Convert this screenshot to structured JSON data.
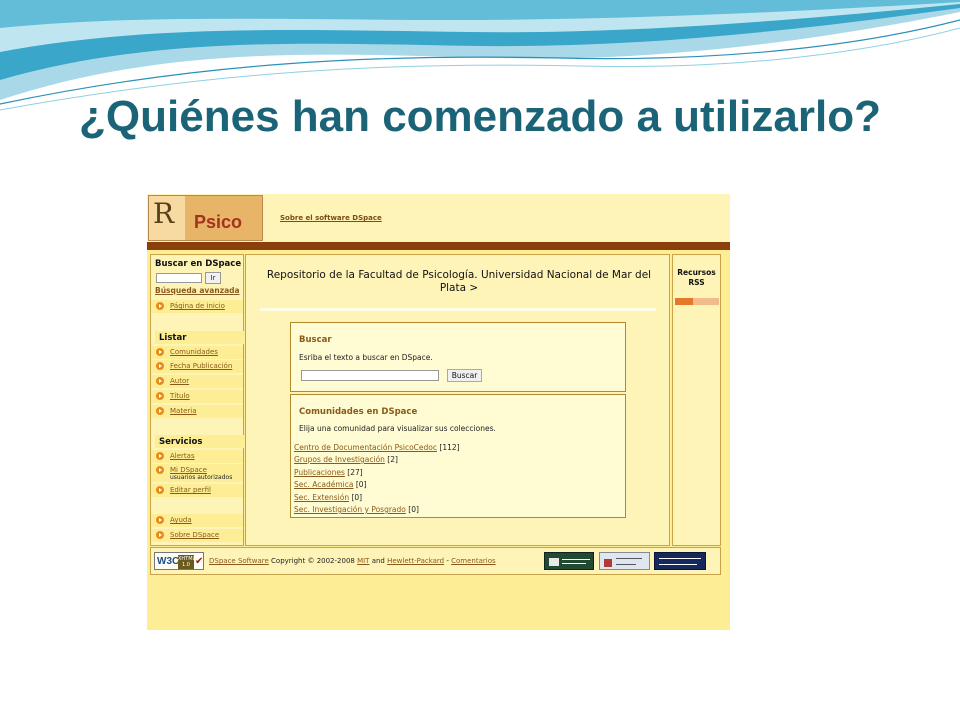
{
  "slide": {
    "title": "¿Quiénes han comenzado a utilizarlo?"
  },
  "header": {
    "logo_letter": "R",
    "logo_name": "Psico",
    "about_link": "Sobre el software DSpace"
  },
  "sidebar": {
    "search_title": "Buscar en DSpace",
    "search_button": "Ir",
    "advanced_link": "Búsqueda avanzada",
    "home_link": "Página de inicio",
    "list_title": "Listar",
    "list_items": [
      {
        "label": "Comunidades"
      },
      {
        "label": "Fecha Publicación"
      },
      {
        "label": "Autor"
      },
      {
        "label": "Título"
      },
      {
        "label": "Materia"
      }
    ],
    "services_title": "Servicios",
    "service_items": [
      {
        "label": "Alertas"
      },
      {
        "label": "Mi DSpace",
        "sub": "usuarios autorizados"
      },
      {
        "label": "Editar perfil"
      }
    ],
    "help_items": [
      {
        "label": "Ayuda"
      },
      {
        "label": "Sobre DSpace"
      }
    ]
  },
  "main": {
    "repo_title": "Repositorio de la Facultad de Psicología. Universidad Nacional de Mar del Plata >",
    "search_box": {
      "title": "Buscar",
      "prompt": "Esriba el texto a buscar en DSpace.",
      "button": "Buscar"
    },
    "communities_box": {
      "title": "Comunidades en DSpace",
      "prompt": "Elija una comunidad para visualizar sus colecciones.",
      "items": [
        {
          "name": "Centro de Documentación PsicoCedoc",
          "count": "[112]"
        },
        {
          "name": "Grupos de Investigación",
          "count": "[2]"
        },
        {
          "name": "Publicaciones",
          "count": "[27]"
        },
        {
          "name": "Sec. Académica",
          "count": "[0]"
        },
        {
          "name": "Sec. Extensión",
          "count": "[0]"
        },
        {
          "name": "Sec. Investigación y Posgrado",
          "count": "[0]"
        }
      ]
    }
  },
  "right": {
    "rss_title_line1": "Recursos",
    "rss_title_line2": "RSS"
  },
  "footer": {
    "w3c_label": "W3C",
    "w3c_badge": "XHTML 1.0",
    "dspace_link": "DSpace Software",
    "copyright": " Copyright © 2002-2008 ",
    "mit_link": "MIT",
    "and_text": " and ",
    "hp_link": "Hewlett-Packard",
    "dash": " - ",
    "comments_link": "Comentarios"
  },
  "colors": {
    "slide_title": "#1b6478",
    "page_bg": "#fdee96",
    "header_bar": "#8b3f0a",
    "link": "#8a5a1a",
    "bullet": "#e98a18"
  }
}
